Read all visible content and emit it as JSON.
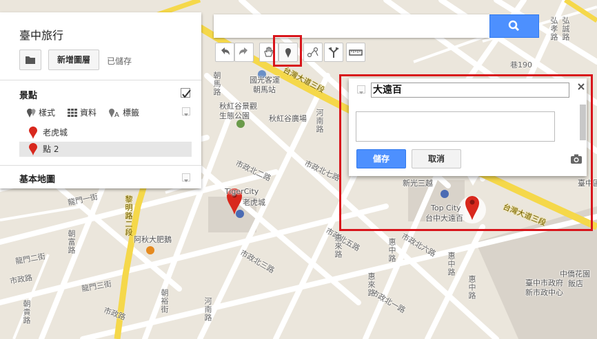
{
  "panel": {
    "map_title": "臺中旅行",
    "add_layer_label": "新增圖層",
    "saved_status": "已儲存",
    "layer": {
      "title": "景點",
      "tools": {
        "style_label": "樣式",
        "data_label": "資料",
        "labels_label": "標籤"
      },
      "places": [
        {
          "label": "老虎城",
          "selected": false
        },
        {
          "label": "點 2",
          "selected": true
        }
      ]
    },
    "base_map_title": "基本地圖"
  },
  "search": {
    "placeholder": ""
  },
  "toolbar": {
    "tools": [
      "undo-icon",
      "redo-icon",
      "hand-icon",
      "marker-icon",
      "draw-line-icon",
      "directions-icon",
      "ruler-icon"
    ],
    "highlighted_tool": "marker-icon"
  },
  "info_window": {
    "name_value": "大遠百",
    "description_value": "",
    "save_label": "儲存",
    "cancel_label": "取消"
  },
  "map_labels": {
    "guoguang": "國光客運",
    "chaoma": "朝馬站",
    "qiuhong_park": "秋紅谷景觀",
    "qiuhong_park2": "生態公園",
    "qiuhong_square": "秋紅谷廣場",
    "tigercity": "TigerCity",
    "tigercity_zh": "老虎城",
    "akiu": "阿秋大肥鵝",
    "xinguang": "新光三越",
    "topcity": "Top City",
    "topcity_zh": "台中大遠百",
    "city_gov": "臺中市政府",
    "city_gov2": "新市政中心",
    "hotel": "中僑花園",
    "hotel2": "飯店",
    "shizhengbei2": "市政北二路",
    "shizhengbei7": "市政北七路",
    "shizhengbei5": "市政北五路",
    "shizhengbei6": "市政北六路",
    "shizhengbei3": "市政北三路",
    "shizhengbei1": "市政北一路",
    "shizheng": "市政路",
    "longmen1": "龍門一街",
    "longmen2": "龍門二街",
    "longmen3": "龍門三街",
    "taiwan3": "台灣大道三段",
    "taiwan3b": "台灣大道三段",
    "liming": "黎明路二段",
    "chaofu": "朝富路",
    "chaoma_rd": "朝馬路",
    "huilai": "惠來路",
    "hunan": "河南路",
    "huizhong": "惠中路",
    "chaogui": "朝貴路",
    "chaoyu": "朝裕街",
    "longmen_rd": "龍門路",
    "gongyi": "公益路",
    "daye": "大業路",
    "wenxin": "文心路",
    "huiwen": "惠文路",
    "hongmao": "弘孝路",
    "hongqian": "弘誠路",
    "lane190": "巷190",
    "taiwan_area": "臺中區",
    "rd_1": "市政北",
    "rd_2": "市",
    "rd_3": "中",
    "rd_4": "區"
  }
}
